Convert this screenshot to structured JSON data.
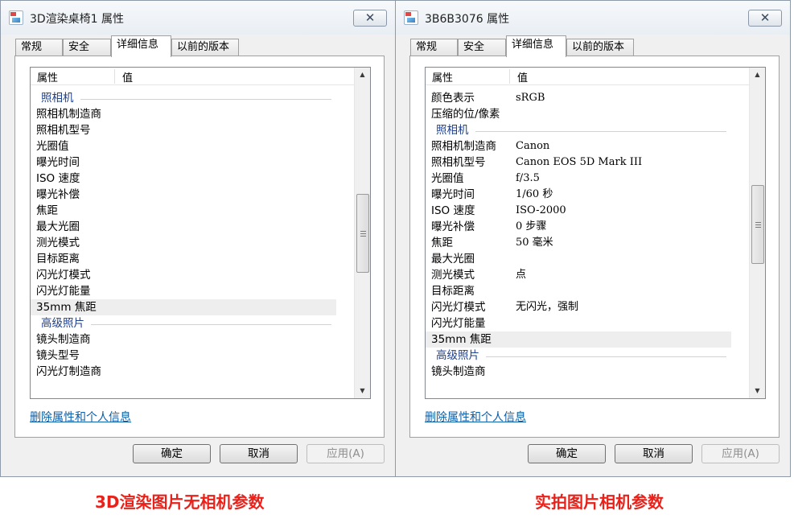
{
  "left": {
    "title": "3D渲染桌椅1 属性",
    "close_label": "✕",
    "tabs": [
      "常规",
      "安全",
      "详细信息",
      "以前的版本"
    ],
    "active_tab": 2,
    "columns": {
      "property": "属性",
      "value": "值"
    },
    "rows": [
      {
        "k": "",
        "type": "partial"
      },
      {
        "k": "照相机",
        "type": "group"
      },
      {
        "k": "照相机制造商"
      },
      {
        "k": "照相机型号"
      },
      {
        "k": "光圈值"
      },
      {
        "k": "曝光时间"
      },
      {
        "k": "ISO 速度"
      },
      {
        "k": "曝光补偿"
      },
      {
        "k": "焦距"
      },
      {
        "k": "最大光圈"
      },
      {
        "k": "测光模式"
      },
      {
        "k": "目标距离"
      },
      {
        "k": "闪光灯模式"
      },
      {
        "k": "闪光灯能量"
      },
      {
        "k": "35mm 焦距",
        "highlight": true
      },
      {
        "k": "高级照片",
        "type": "group"
      },
      {
        "k": "镜头制造商"
      },
      {
        "k": "镜头型号"
      },
      {
        "k": "闪光灯制造商"
      }
    ],
    "scroll": {
      "thumb_top_fraction": 0.37,
      "thumb_size_fraction": 0.26
    },
    "remove_link": "删除属性和个人信息",
    "buttons": {
      "ok": "确定",
      "cancel": "取消",
      "apply": "应用(A)"
    }
  },
  "right": {
    "title": "3B6B3076 属性",
    "close_label": "✕",
    "tabs": [
      "常规",
      "安全",
      "详细信息",
      "以前的版本"
    ],
    "active_tab": 2,
    "columns": {
      "property": "属性",
      "value": "值"
    },
    "rows": [
      {
        "k": "",
        "v": "",
        "type": "partial"
      },
      {
        "k": "颜色表示",
        "v": "sRGB"
      },
      {
        "k": "压缩的位/像素",
        "v": ""
      },
      {
        "k": "照相机",
        "type": "group"
      },
      {
        "k": "照相机制造商",
        "v": "Canon"
      },
      {
        "k": "照相机型号",
        "v": "Canon EOS 5D Mark III"
      },
      {
        "k": "光圈值",
        "v": "f/3.5"
      },
      {
        "k": "曝光时间",
        "v": "1/60 秒"
      },
      {
        "k": "ISO 速度",
        "v": "ISO-2000"
      },
      {
        "k": "曝光补偿",
        "v": "0 步骤"
      },
      {
        "k": "焦距",
        "v": "50 毫米"
      },
      {
        "k": "最大光圈",
        "v": ""
      },
      {
        "k": "测光模式",
        "v": "点"
      },
      {
        "k": "目标距离",
        "v": ""
      },
      {
        "k": "闪光灯模式",
        "v": "无闪光，强制"
      },
      {
        "k": "闪光灯能量",
        "v": ""
      },
      {
        "k": "35mm 焦距",
        "v": "",
        "highlight": true
      },
      {
        "k": "高级照片",
        "type": "group"
      },
      {
        "k": "镜头制造商",
        "v": ""
      }
    ],
    "scroll": {
      "thumb_top_fraction": 0.34,
      "thumb_size_fraction": 0.26
    },
    "remove_link": "删除属性和个人信息",
    "buttons": {
      "ok": "确定",
      "cancel": "取消",
      "apply": "应用(A)"
    }
  },
  "captions": {
    "left": "3D渲染图片无相机参数",
    "right": "实拍图片相机参数"
  }
}
